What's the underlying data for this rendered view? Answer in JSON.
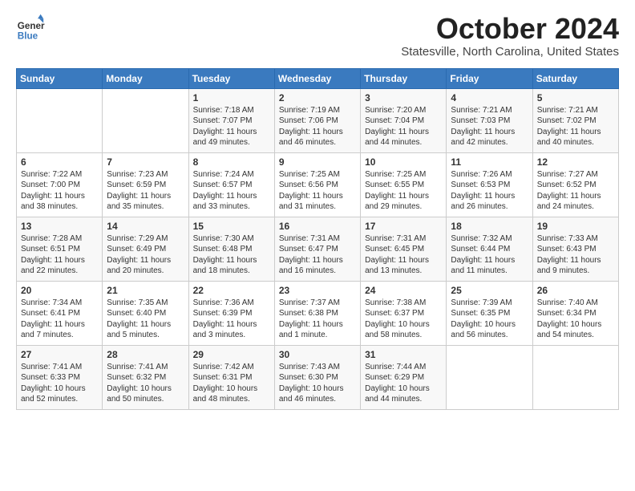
{
  "header": {
    "logo_line1": "General",
    "logo_line2": "Blue",
    "month": "October 2024",
    "location": "Statesville, North Carolina, United States"
  },
  "days_of_week": [
    "Sunday",
    "Monday",
    "Tuesday",
    "Wednesday",
    "Thursday",
    "Friday",
    "Saturday"
  ],
  "weeks": [
    [
      {
        "day": "",
        "info": ""
      },
      {
        "day": "",
        "info": ""
      },
      {
        "day": "1",
        "info": "Sunrise: 7:18 AM\nSunset: 7:07 PM\nDaylight: 11 hours\nand 49 minutes."
      },
      {
        "day": "2",
        "info": "Sunrise: 7:19 AM\nSunset: 7:06 PM\nDaylight: 11 hours\nand 46 minutes."
      },
      {
        "day": "3",
        "info": "Sunrise: 7:20 AM\nSunset: 7:04 PM\nDaylight: 11 hours\nand 44 minutes."
      },
      {
        "day": "4",
        "info": "Sunrise: 7:21 AM\nSunset: 7:03 PM\nDaylight: 11 hours\nand 42 minutes."
      },
      {
        "day": "5",
        "info": "Sunrise: 7:21 AM\nSunset: 7:02 PM\nDaylight: 11 hours\nand 40 minutes."
      }
    ],
    [
      {
        "day": "6",
        "info": "Sunrise: 7:22 AM\nSunset: 7:00 PM\nDaylight: 11 hours\nand 38 minutes."
      },
      {
        "day": "7",
        "info": "Sunrise: 7:23 AM\nSunset: 6:59 PM\nDaylight: 11 hours\nand 35 minutes."
      },
      {
        "day": "8",
        "info": "Sunrise: 7:24 AM\nSunset: 6:57 PM\nDaylight: 11 hours\nand 33 minutes."
      },
      {
        "day": "9",
        "info": "Sunrise: 7:25 AM\nSunset: 6:56 PM\nDaylight: 11 hours\nand 31 minutes."
      },
      {
        "day": "10",
        "info": "Sunrise: 7:25 AM\nSunset: 6:55 PM\nDaylight: 11 hours\nand 29 minutes."
      },
      {
        "day": "11",
        "info": "Sunrise: 7:26 AM\nSunset: 6:53 PM\nDaylight: 11 hours\nand 26 minutes."
      },
      {
        "day": "12",
        "info": "Sunrise: 7:27 AM\nSunset: 6:52 PM\nDaylight: 11 hours\nand 24 minutes."
      }
    ],
    [
      {
        "day": "13",
        "info": "Sunrise: 7:28 AM\nSunset: 6:51 PM\nDaylight: 11 hours\nand 22 minutes."
      },
      {
        "day": "14",
        "info": "Sunrise: 7:29 AM\nSunset: 6:49 PM\nDaylight: 11 hours\nand 20 minutes."
      },
      {
        "day": "15",
        "info": "Sunrise: 7:30 AM\nSunset: 6:48 PM\nDaylight: 11 hours\nand 18 minutes."
      },
      {
        "day": "16",
        "info": "Sunrise: 7:31 AM\nSunset: 6:47 PM\nDaylight: 11 hours\nand 16 minutes."
      },
      {
        "day": "17",
        "info": "Sunrise: 7:31 AM\nSunset: 6:45 PM\nDaylight: 11 hours\nand 13 minutes."
      },
      {
        "day": "18",
        "info": "Sunrise: 7:32 AM\nSunset: 6:44 PM\nDaylight: 11 hours\nand 11 minutes."
      },
      {
        "day": "19",
        "info": "Sunrise: 7:33 AM\nSunset: 6:43 PM\nDaylight: 11 hours\nand 9 minutes."
      }
    ],
    [
      {
        "day": "20",
        "info": "Sunrise: 7:34 AM\nSunset: 6:41 PM\nDaylight: 11 hours\nand 7 minutes."
      },
      {
        "day": "21",
        "info": "Sunrise: 7:35 AM\nSunset: 6:40 PM\nDaylight: 11 hours\nand 5 minutes."
      },
      {
        "day": "22",
        "info": "Sunrise: 7:36 AM\nSunset: 6:39 PM\nDaylight: 11 hours\nand 3 minutes."
      },
      {
        "day": "23",
        "info": "Sunrise: 7:37 AM\nSunset: 6:38 PM\nDaylight: 11 hours\nand 1 minute."
      },
      {
        "day": "24",
        "info": "Sunrise: 7:38 AM\nSunset: 6:37 PM\nDaylight: 10 hours\nand 58 minutes."
      },
      {
        "day": "25",
        "info": "Sunrise: 7:39 AM\nSunset: 6:35 PM\nDaylight: 10 hours\nand 56 minutes."
      },
      {
        "day": "26",
        "info": "Sunrise: 7:40 AM\nSunset: 6:34 PM\nDaylight: 10 hours\nand 54 minutes."
      }
    ],
    [
      {
        "day": "27",
        "info": "Sunrise: 7:41 AM\nSunset: 6:33 PM\nDaylight: 10 hours\nand 52 minutes."
      },
      {
        "day": "28",
        "info": "Sunrise: 7:41 AM\nSunset: 6:32 PM\nDaylight: 10 hours\nand 50 minutes."
      },
      {
        "day": "29",
        "info": "Sunrise: 7:42 AM\nSunset: 6:31 PM\nDaylight: 10 hours\nand 48 minutes."
      },
      {
        "day": "30",
        "info": "Sunrise: 7:43 AM\nSunset: 6:30 PM\nDaylight: 10 hours\nand 46 minutes."
      },
      {
        "day": "31",
        "info": "Sunrise: 7:44 AM\nSunset: 6:29 PM\nDaylight: 10 hours\nand 44 minutes."
      },
      {
        "day": "",
        "info": ""
      },
      {
        "day": "",
        "info": ""
      }
    ]
  ]
}
